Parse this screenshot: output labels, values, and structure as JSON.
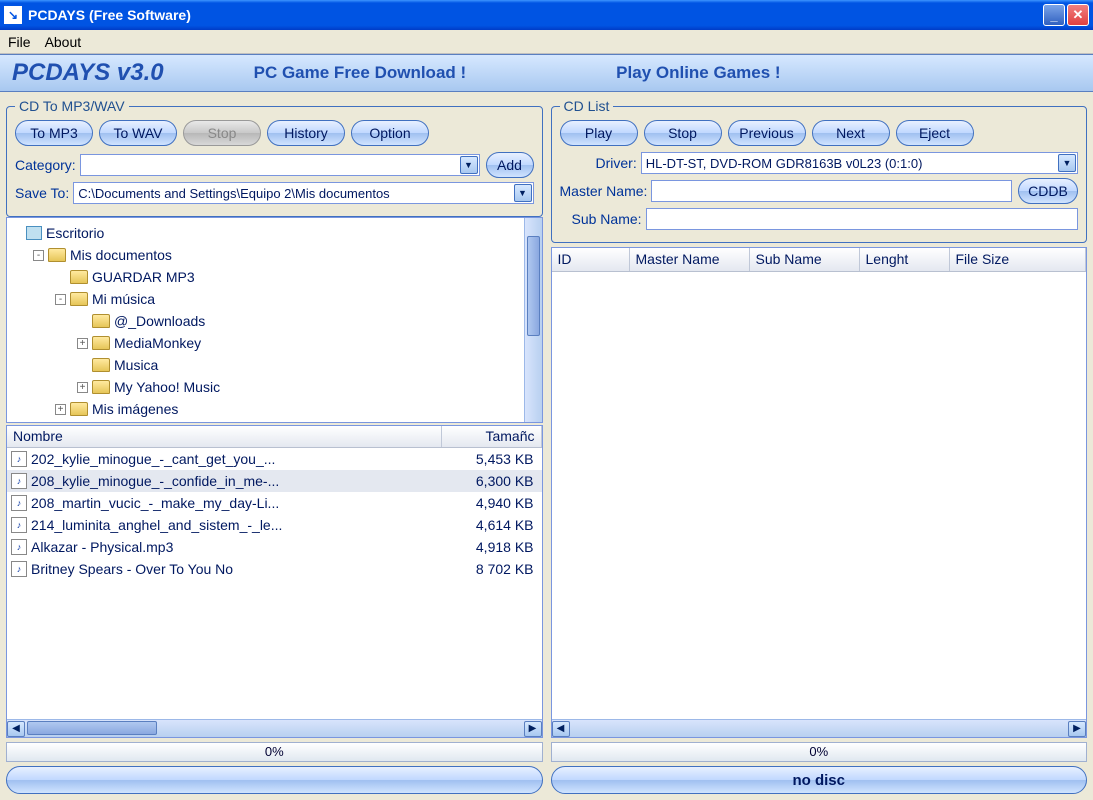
{
  "window": {
    "title": "PCDAYS (Free Software)"
  },
  "menu": {
    "file": "File",
    "about": "About"
  },
  "banner": {
    "title": "PCDAYS v3.0",
    "link1": "PC Game Free Download !",
    "link2": "Play Online Games !"
  },
  "left": {
    "legend": "CD To MP3/WAV",
    "btn_mp3": "To MP3",
    "btn_wav": "To WAV",
    "btn_stop": "Stop",
    "btn_history": "History",
    "btn_option": "Option",
    "category_label": "Category:",
    "category_value": "",
    "btn_add": "Add",
    "saveto_label": "Save To:",
    "saveto_value": "C:\\Documents and Settings\\Equipo 2\\Mis documentos",
    "tree": [
      {
        "indent": 0,
        "exp": "",
        "icon": "desk",
        "label": "Escritorio"
      },
      {
        "indent": 1,
        "exp": "-",
        "icon": "folder",
        "label": "Mis documentos"
      },
      {
        "indent": 2,
        "exp": "",
        "icon": "folder",
        "label": "GUARDAR MP3"
      },
      {
        "indent": 2,
        "exp": "-",
        "icon": "folder",
        "label": "Mi música"
      },
      {
        "indent": 3,
        "exp": "",
        "icon": "folder",
        "label": "@_Downloads"
      },
      {
        "indent": 3,
        "exp": "+",
        "icon": "folder",
        "label": "MediaMonkey"
      },
      {
        "indent": 3,
        "exp": "",
        "icon": "folder",
        "label": "Musica"
      },
      {
        "indent": 3,
        "exp": "+",
        "icon": "folder",
        "label": "My Yahoo! Music"
      },
      {
        "indent": 2,
        "exp": "+",
        "icon": "folder",
        "label": "Mis imágenes"
      }
    ],
    "file_cols": {
      "name": "Nombre",
      "size": "Tamañc"
    },
    "files": [
      {
        "name": "202_kylie_minogue_-_cant_get_you_...",
        "size": "5,453 KB",
        "sel": false
      },
      {
        "name": "208_kylie_minogue_-_confide_in_me-...",
        "size": "6,300 KB",
        "sel": true
      },
      {
        "name": "208_martin_vucic_-_make_my_day-Li...",
        "size": "4,940 KB",
        "sel": false
      },
      {
        "name": "214_luminita_anghel_and_sistem_-_le...",
        "size": "4,614 KB",
        "sel": false
      },
      {
        "name": "Alkazar - Physical.mp3",
        "size": "4,918 KB",
        "sel": false
      },
      {
        "name": "Britney  Spears - Over  To  You  No",
        "size": "8 702 KB",
        "sel": false
      }
    ],
    "progress": "0%",
    "status": ""
  },
  "right": {
    "legend": "CD List",
    "btn_play": "Play",
    "btn_stop": "Stop",
    "btn_prev": "Previous",
    "btn_next": "Next",
    "btn_eject": "Eject",
    "driver_label": "Driver:",
    "driver_value": "HL-DT-ST, DVD-ROM GDR8163B v0L23 (0:1:0)",
    "master_label": "Master Name:",
    "master_value": "",
    "btn_cddb": "CDDB",
    "sub_label": "Sub Name:",
    "sub_value": "",
    "cols": {
      "id": "ID",
      "master": "Master Name",
      "sub": "Sub Name",
      "len": "Lenght",
      "size": "File Size"
    },
    "progress": "0%",
    "status": "no disc"
  }
}
